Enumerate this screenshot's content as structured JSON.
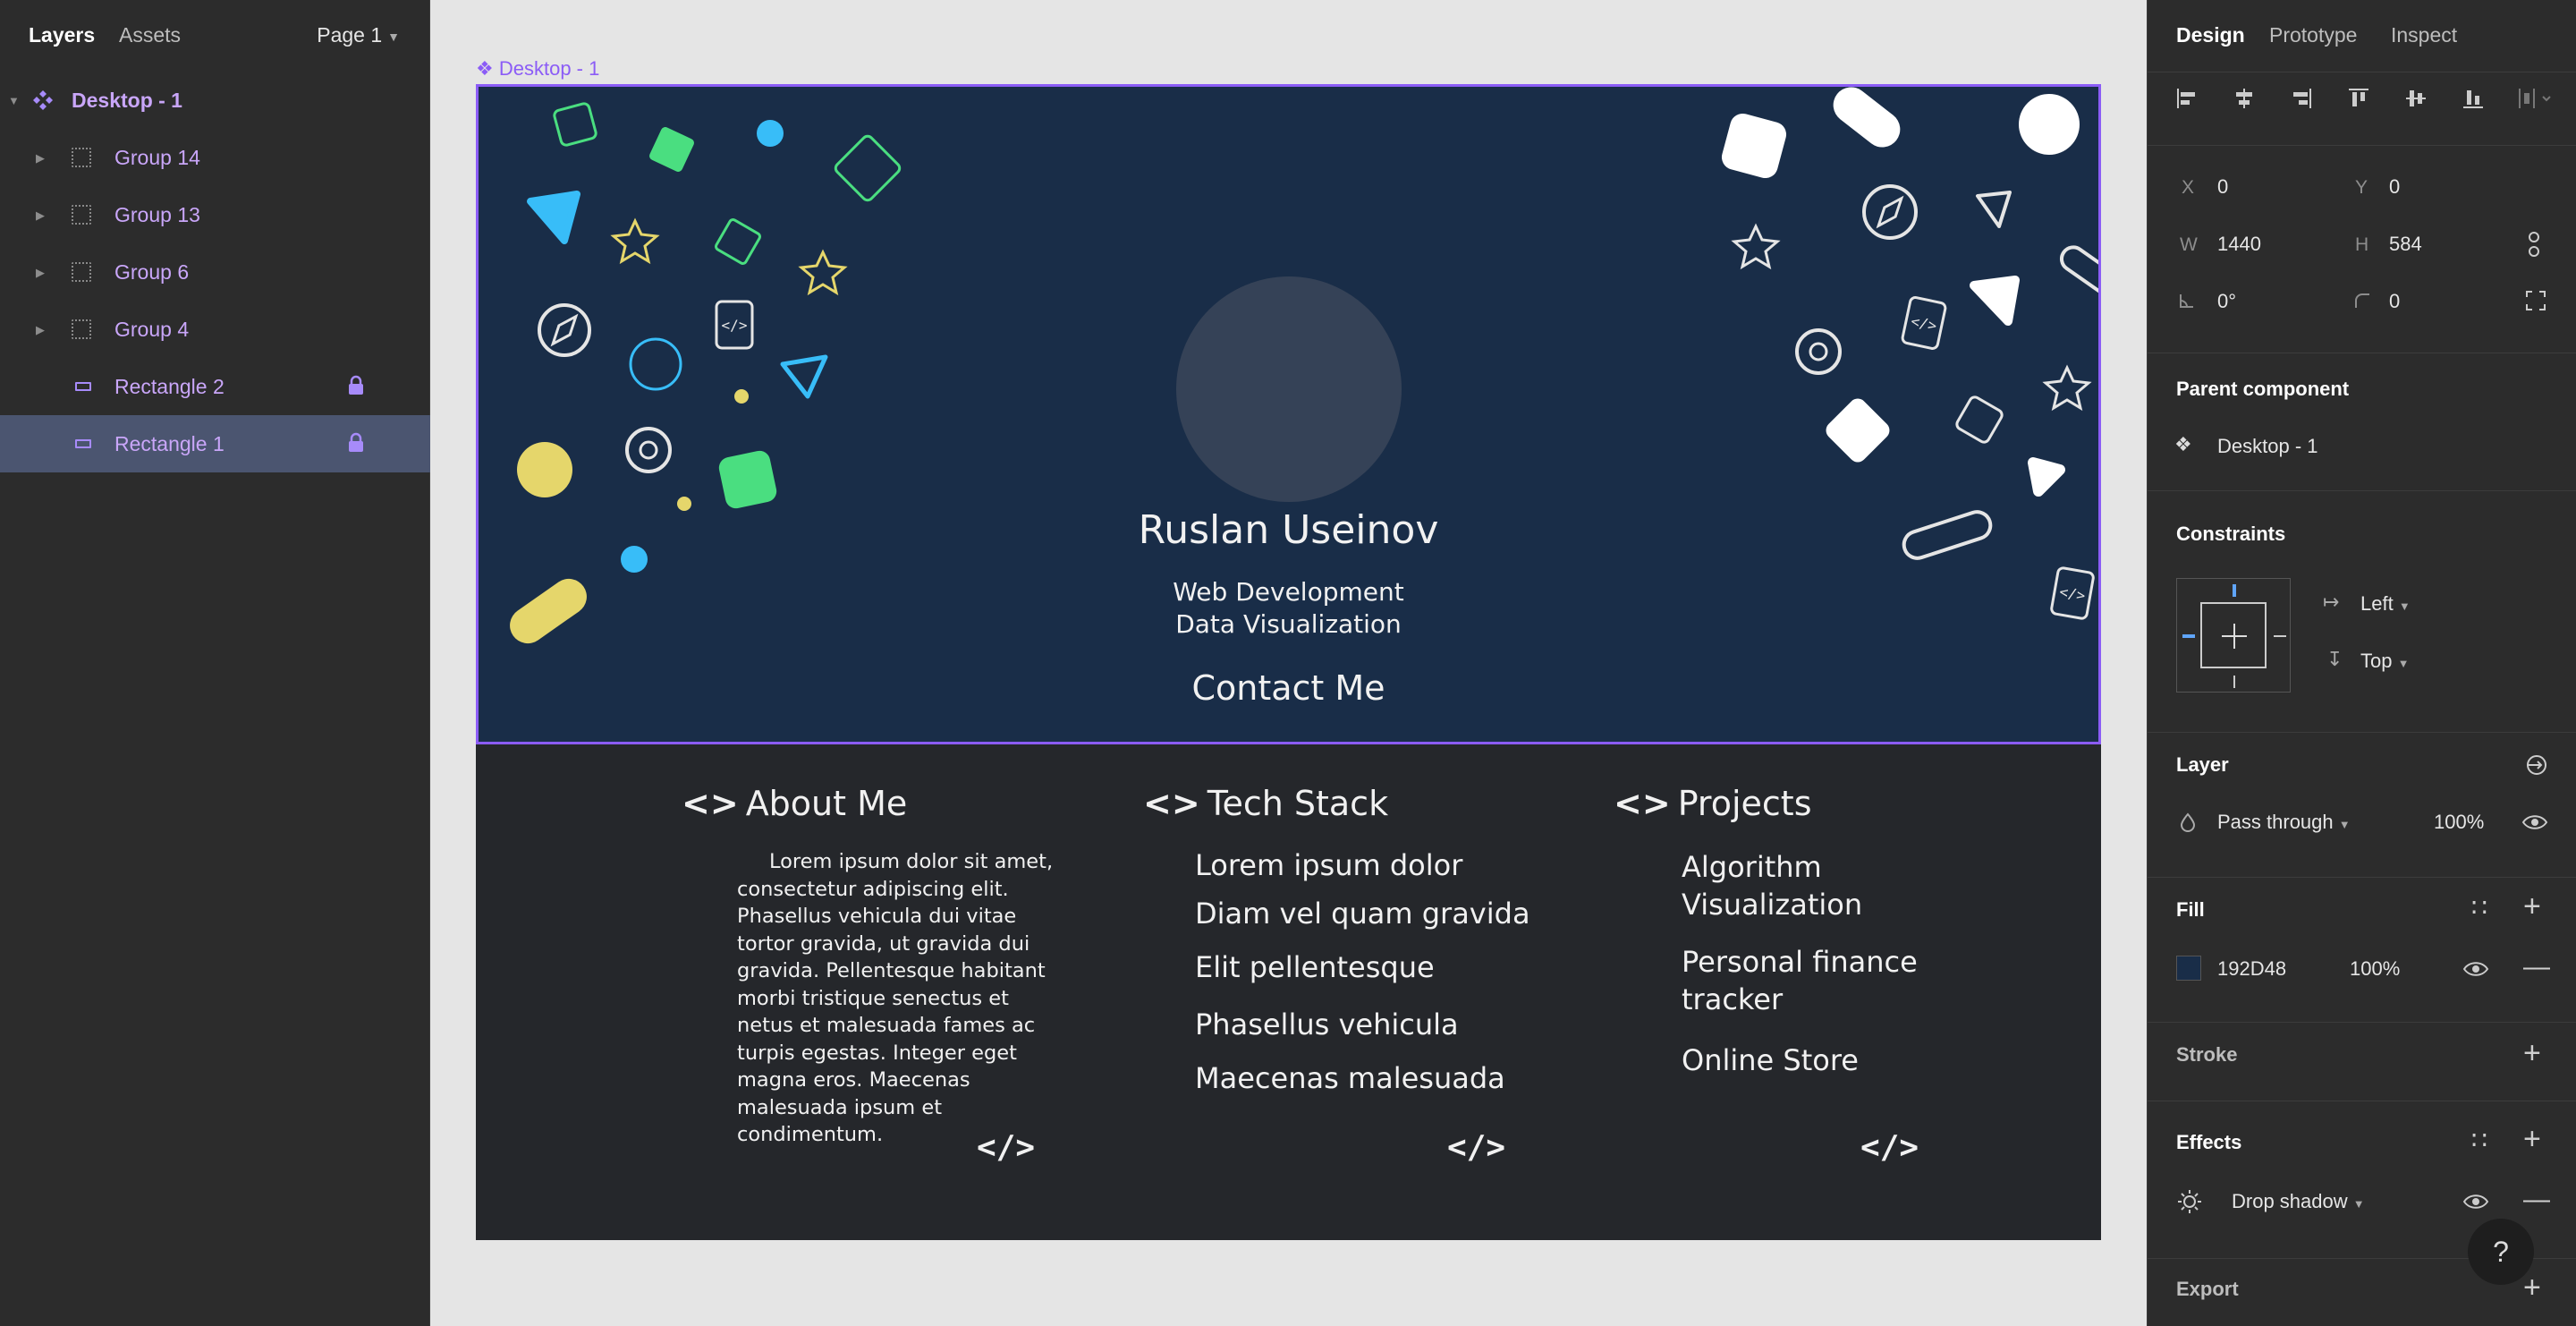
{
  "left_panel": {
    "tabs": [
      "Layers",
      "Assets"
    ],
    "page": "Page 1",
    "layers": [
      {
        "name": "Desktop - 1"
      },
      {
        "name": "Group 14"
      },
      {
        "name": "Group 13"
      },
      {
        "name": "Group 6"
      },
      {
        "name": "Group 4"
      },
      {
        "name": "Rectangle 2"
      },
      {
        "name": "Rectangle 1"
      }
    ]
  },
  "canvas": {
    "frame_label": "Desktop - 1",
    "hero": {
      "name": "Ruslan Useinov",
      "subtitle_1": "Web Development",
      "subtitle_2": "Data Visualization",
      "contact": "Contact Me"
    },
    "about": {
      "title": "About Me",
      "text": "Lorem ipsum dolor sit amet, consectetur adipiscing elit. Phasellus vehicula dui vitae tortor gravida, ut gravida dui gravida. Pellentesque habitant morbi tristique senectus et netus et malesuada fames ac turpis egestas. Integer eget magna eros. Maecenas malesuada ipsum et condimentum."
    },
    "tech": {
      "title": "Tech Stack",
      "items": [
        "Lorem ipsum  dolor",
        "Diam vel quam gravida",
        "Elit pellentesque",
        "Phasellus vehicula",
        "Maecenas malesuada"
      ]
    },
    "projects": {
      "title": "Projects",
      "items": [
        "Algorithm",
        "Visualization",
        "Personal finance",
        "tracker",
        "Online Store"
      ]
    },
    "bracket_glyph": "<>",
    "code_glyph": "</>"
  },
  "right_panel": {
    "tabs": [
      "Design",
      "Prototype",
      "Inspect"
    ],
    "x_label": "X",
    "x": "0",
    "y_label": "Y",
    "y": "0",
    "w_label": "W",
    "w": "1440",
    "h_label": "H",
    "h": "584",
    "rotation": "0°",
    "radius": "0",
    "parent_component_title": "Parent component",
    "parent_component": "Desktop - 1",
    "constraints_title": "Constraints",
    "constraint_h": "Left",
    "constraint_v": "Top",
    "layer_title": "Layer",
    "blend_mode": "Pass through",
    "layer_opacity": "100%",
    "fill_title": "Fill",
    "fill_hex": "192D48",
    "fill_opacity": "100%",
    "stroke_title": "Stroke",
    "effects_title": "Effects",
    "effect": "Drop shadow",
    "export_title": "Export",
    "help": "?"
  },
  "colors": {
    "hero_bg": "#192d48",
    "content_bg": "#25272b",
    "selection": "#8b5cf6",
    "accent_green": "#4ade80",
    "accent_blue": "#38bdf8",
    "accent_yellow": "#e5d66b"
  }
}
